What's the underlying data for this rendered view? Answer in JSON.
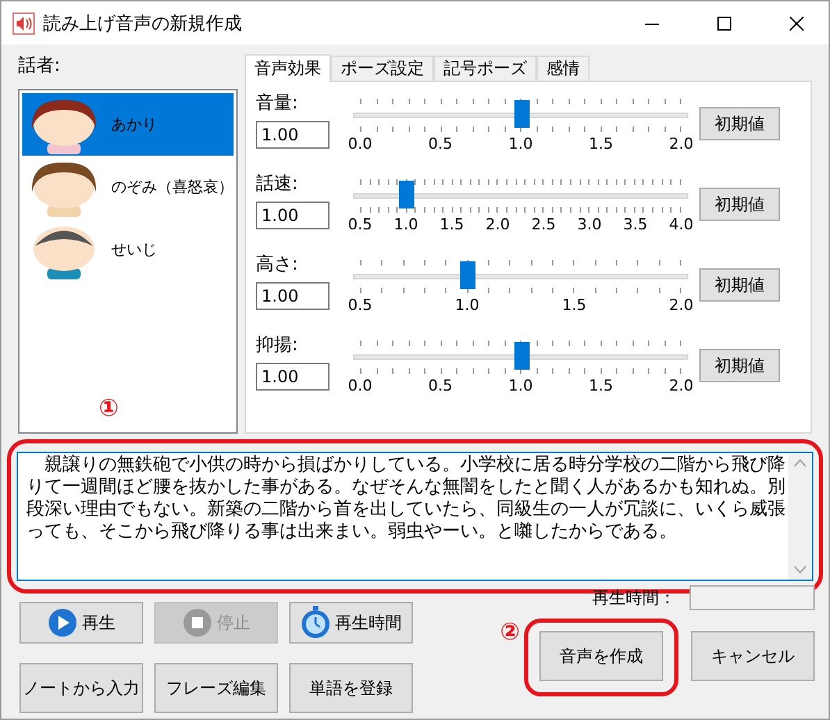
{
  "window": {
    "title": "読み上げ音声の新規作成"
  },
  "speakers": {
    "label": "話者:",
    "items": [
      {
        "name": "あかり",
        "selected": true,
        "kind": "woman"
      },
      {
        "name": "のぞみ（喜怒哀）",
        "selected": false,
        "kind": "girl"
      },
      {
        "name": "せいじ",
        "selected": false,
        "kind": "man"
      }
    ]
  },
  "tabs": [
    {
      "label": "音声効果",
      "selected": true
    },
    {
      "label": "ポーズ設定",
      "selected": false
    },
    {
      "label": "記号ポーズ",
      "selected": false
    },
    {
      "label": "感情",
      "selected": false
    }
  ],
  "sliders": [
    {
      "label": "音量:",
      "value": "1.00",
      "level": 0.5,
      "scale": [
        "0.0",
        "0.5",
        "1.0",
        "1.5",
        "2.0"
      ],
      "reset": "初期値"
    },
    {
      "label": "話速:",
      "value": "1.00",
      "level": 0.143,
      "scale": [
        "0.5",
        "1.0",
        "1.5",
        "2.0",
        "2.5",
        "3.0",
        "3.5",
        "4.0"
      ],
      "reset": "初期値"
    },
    {
      "label": "高さ:",
      "value": "1.00",
      "level": 0.333,
      "scale": [
        "0.5",
        "1.0",
        "1.5",
        "2.0"
      ],
      "reset": "初期値"
    },
    {
      "label": "抑揚:",
      "value": "1.00",
      "level": 0.5,
      "scale": [
        "0.0",
        "0.5",
        "1.0",
        "1.5",
        "2.0"
      ],
      "reset": "初期値"
    }
  ],
  "markers": [
    "①",
    "②"
  ],
  "text": "　親譲りの無鉄砲で小供の時から損ばかりしている。小学校に居る時分学校の二階から飛び降りて一週間ほど腰を抜かした事がある。なぜそんな無闇をしたと聞く人があるかも知れぬ。別段深い理由でもない。新築の二階から首を出していたら、同級生の一人が冗談に、いくら威張っても、そこから飛び降りる事は出来まい。弱虫やーい。と囃したからである。",
  "play_buttons": [
    {
      "label": "再生",
      "kind": "play",
      "disabled": false
    },
    {
      "label": "停止",
      "kind": "stop",
      "disabled": true
    },
    {
      "label": "再生時間",
      "kind": "stopwatch",
      "disabled": false
    }
  ],
  "tool_buttons": [
    "ノートから入力",
    "フレーズ編集",
    "単語を登録"
  ],
  "playback_time": {
    "label": "再生時間："
  },
  "dialog_buttons": [
    "音声を作成",
    "キャンセル"
  ]
}
